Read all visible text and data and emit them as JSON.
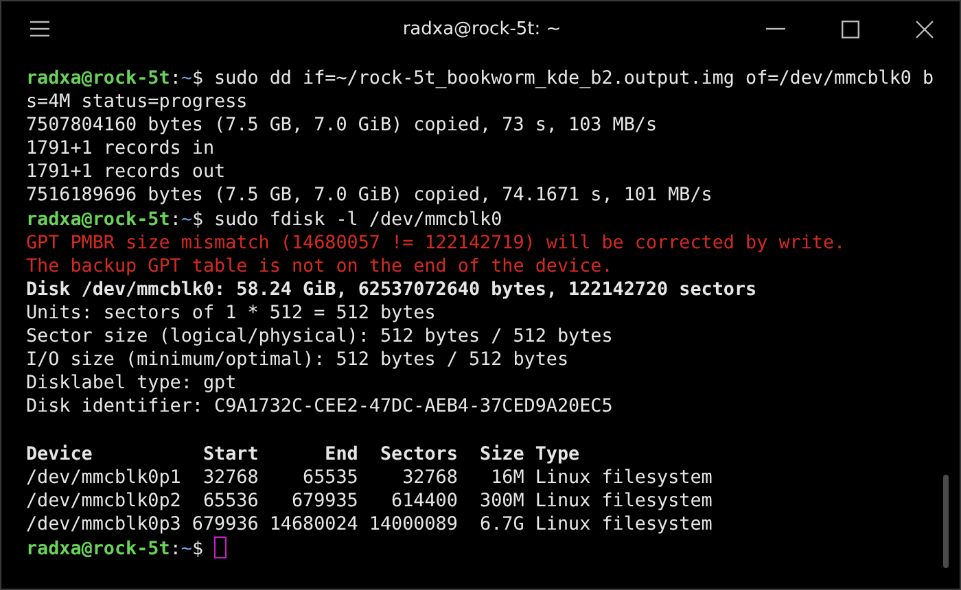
{
  "window": {
    "title": "radxa@rock-5t: ~"
  },
  "terminal": {
    "lines": [
      {
        "kind": "prompt",
        "user": "radxa@rock-5t",
        "separator": ":",
        "path": "~",
        "symbol": "$",
        "command": " sudo dd if=~/rock-5t_bookworm_kde_b2.output.img of=/dev/mmcblk0 b",
        "cursor": false
      },
      {
        "kind": "output",
        "text": "s=4M status=progress"
      },
      {
        "kind": "output",
        "text": "7507804160 bytes (7.5 GB, 7.0 GiB) copied, 73 s, 103 MB/s"
      },
      {
        "kind": "output",
        "text": "1791+1 records in"
      },
      {
        "kind": "output",
        "text": "1791+1 records out"
      },
      {
        "kind": "output",
        "text": "7516189696 bytes (7.5 GB, 7.0 GiB) copied, 74.1671 s, 101 MB/s"
      },
      {
        "kind": "prompt",
        "user": "radxa@rock-5t",
        "separator": ":",
        "path": "~",
        "symbol": "$",
        "command": " sudo fdisk -l /dev/mmcblk0",
        "cursor": false
      },
      {
        "kind": "error",
        "text": "GPT PMBR size mismatch (14680057 != 122142719) will be corrected by write."
      },
      {
        "kind": "error",
        "text": "The backup GPT table is not on the end of the device."
      },
      {
        "kind": "bold",
        "text": "Disk /dev/mmcblk0: 58.24 GiB, 62537072640 bytes, 122142720 sectors"
      },
      {
        "kind": "output",
        "text": "Units: sectors of 1 * 512 = 512 bytes"
      },
      {
        "kind": "output",
        "text": "Sector size (logical/physical): 512 bytes / 512 bytes"
      },
      {
        "kind": "output",
        "text": "I/O size (minimum/optimal): 512 bytes / 512 bytes"
      },
      {
        "kind": "output",
        "text": "Disklabel type: gpt"
      },
      {
        "kind": "output",
        "text": "Disk identifier: C9A1732C-CEE2-47DC-AEB4-37CED9A20EC5"
      },
      {
        "kind": "blank"
      },
      {
        "kind": "bold",
        "text": "Device          Start      End  Sectors  Size Type"
      },
      {
        "kind": "output",
        "text": "/dev/mmcblk0p1  32768    65535    32768   16M Linux filesystem"
      },
      {
        "kind": "output",
        "text": "/dev/mmcblk0p2  65536   679935   614400  300M Linux filesystem"
      },
      {
        "kind": "output",
        "text": "/dev/mmcblk0p3 679936 14680024 14000089  6.7G Linux filesystem"
      },
      {
        "kind": "prompt",
        "user": "radxa@rock-5t",
        "separator": ":",
        "path": "~",
        "symbol": "$",
        "cursor": true
      }
    ]
  }
}
